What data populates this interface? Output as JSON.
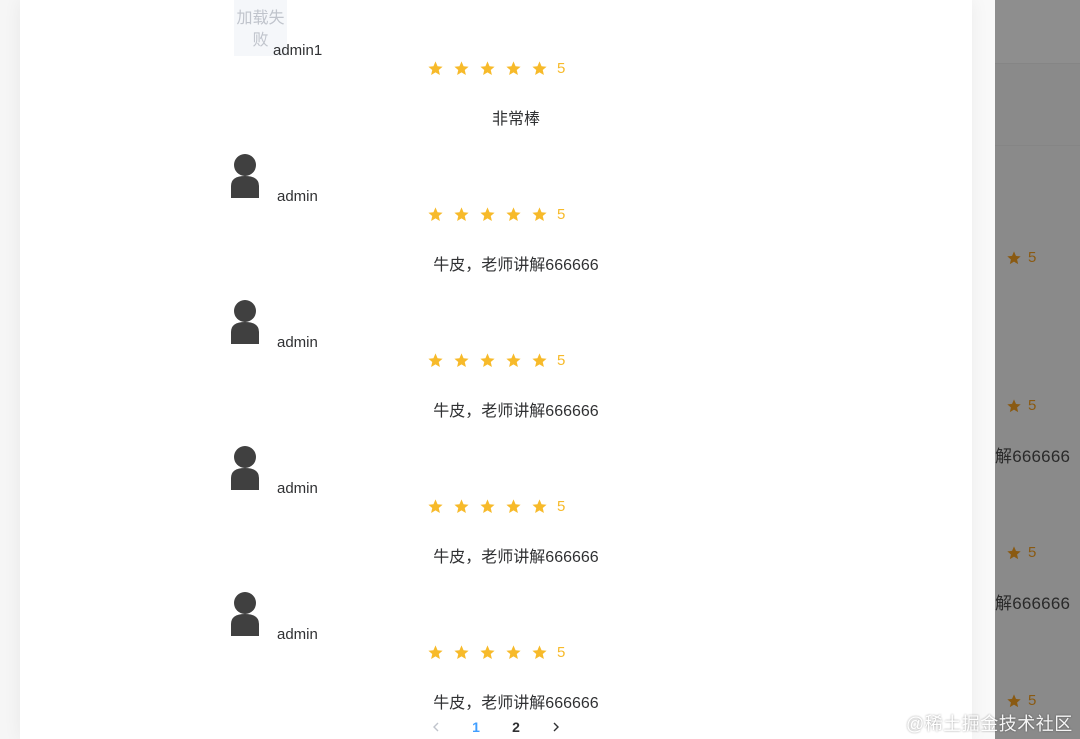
{
  "colors": {
    "star": "#f7ba2a",
    "active_page": "#409eff",
    "text": "#303133"
  },
  "comments": [
    {
      "avatar": "broken",
      "avatar_text": "加载失败",
      "username": "admin1",
      "rating": 5,
      "rating_text": "5",
      "content": "非常棒"
    },
    {
      "avatar": "person-icon",
      "username": "admin",
      "rating": 5,
      "rating_text": "5",
      "content": "牛皮，老师讲解666666"
    },
    {
      "avatar": "person-icon",
      "username": "admin",
      "rating": 5,
      "rating_text": "5",
      "content": "牛皮，老师讲解666666"
    },
    {
      "avatar": "person-icon",
      "username": "admin",
      "rating": 5,
      "rating_text": "5",
      "content": "牛皮，老师讲解666666"
    },
    {
      "avatar": "person-icon",
      "username": "admin",
      "rating": 5,
      "rating_text": "5",
      "content": "牛皮，老师讲解666666"
    }
  ],
  "pagination": {
    "prev_icon": "chevron-left-icon",
    "pages": [
      "1",
      "2"
    ],
    "current": "1",
    "next_icon": "chevron-right-icon"
  },
  "background": {
    "ratings": [
      "5",
      "5",
      "5",
      "5"
    ],
    "text_fragment": "解666666"
  },
  "watermark": "@稀土掘金技术社区"
}
